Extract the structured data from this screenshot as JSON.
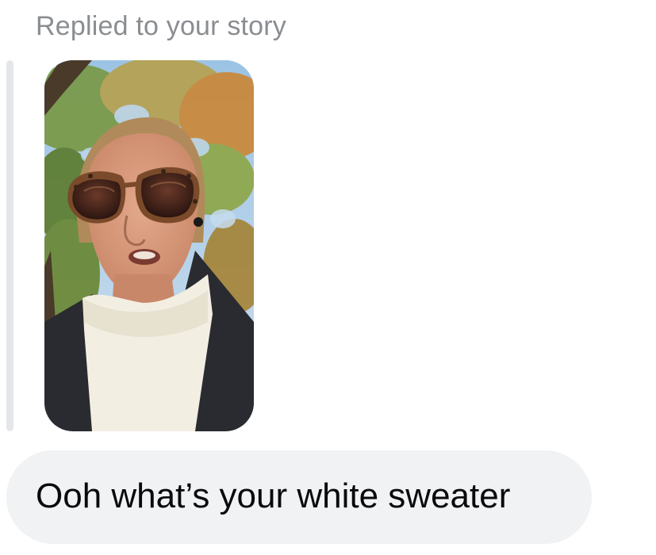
{
  "reply": {
    "caption": "Replied to your story"
  },
  "story": {
    "image_description": "story-photo"
  },
  "message": {
    "text": "Ooh what’s your white sweater"
  },
  "colors": {
    "caption_gray": "#8a8d91",
    "bubble_bg": "#f1f2f4",
    "quote_bar": "#e4e6ea",
    "text": "#0a0a0a"
  }
}
